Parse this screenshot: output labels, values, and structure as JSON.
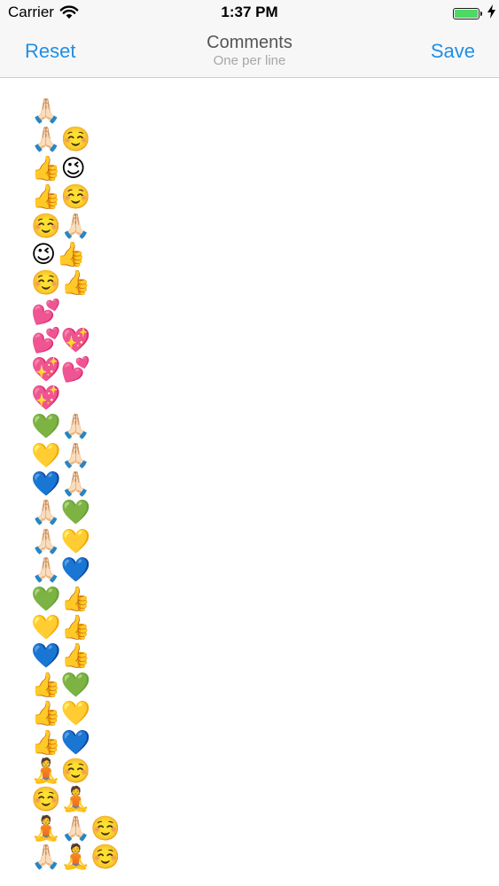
{
  "status_bar": {
    "carrier": "Carrier",
    "time": "1:37 PM",
    "battery_level": 1.0,
    "battery_color": "#4cd964",
    "charging": true
  },
  "nav": {
    "left_button": "Reset",
    "title": "Comments",
    "subtitle": "One per line",
    "right_button": "Save",
    "accent_color": "#1f8fe6"
  },
  "comments": [
    "🙏🏻",
    "🙏🏻☺️",
    "👍😉",
    "👍☺️",
    "☺️🙏🏻",
    "😉👍",
    "☺️👍",
    "💕",
    "💕💖",
    "💖💕",
    "💖",
    "💚🙏🏻",
    "💛🙏🏻",
    "💙🙏🏻",
    "🙏🏻💚",
    "🙏🏻💛",
    "🙏🏻💙",
    "💚👍",
    "💛👍",
    "💙👍",
    "👍💚",
    "👍💛",
    "👍💙",
    "🧘☺️",
    "☺️🧘",
    "🧘🙏🏻☺️",
    "🙏🏻🧘☺️"
  ]
}
